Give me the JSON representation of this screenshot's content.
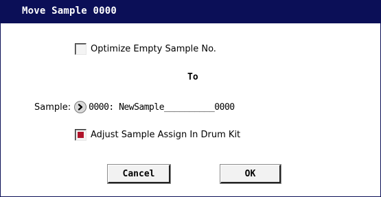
{
  "dialog": {
    "title": "Move Sample 0000"
  },
  "options": {
    "optimize_label": "Optimize Empty Sample No.",
    "optimize_checked": false
  },
  "to_heading": "To",
  "sample": {
    "label": "Sample:",
    "value": "0000: NewSample__________0000"
  },
  "adjust": {
    "label": "Adjust Sample Assign In Drum Kit",
    "checked": true
  },
  "buttons": {
    "cancel": "Cancel",
    "ok": "OK"
  },
  "colors": {
    "titlebar": "#0b0f57",
    "check_mark": "#b0142b"
  },
  "icons": {
    "sample_select": "chevron-right-icon"
  }
}
